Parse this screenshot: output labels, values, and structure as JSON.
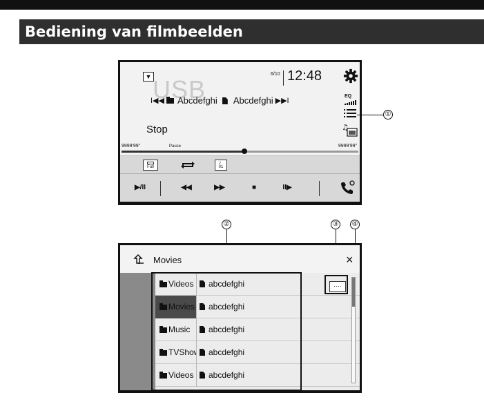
{
  "heading": "Bediening van filmbeelden",
  "player": {
    "dropdown_glyph": "▼",
    "source": "USB",
    "track_counter": "6/10",
    "clock": "12:48",
    "prev_glyph": "I◀◀",
    "folder_name": "Abcdefghi",
    "file_name": "Abcdefghi",
    "next_glyph": "▶▶I",
    "eq_label": "EQ",
    "status": "Stop",
    "time_elapsed": "9999'99\"",
    "pause_label": "Pause",
    "time_remaining": "9999'99\"",
    "progress_fraction": 0.52,
    "mode_full_label": "Full",
    "mode_shuffle_label": "01",
    "controls": {
      "play_pause": "▶/II",
      "rewind": "◀◀",
      "fast_forward": "▶▶",
      "stop": "■",
      "slow": "II▶"
    }
  },
  "callouts": [
    "①",
    "②",
    "③",
    "④"
  ],
  "list": {
    "title": "Movies",
    "close_glyph": "×",
    "more_label": "····",
    "scroll_fraction": 0.0,
    "rows": [
      {
        "folder": "Videos",
        "file": "abcdefghi",
        "selected": false
      },
      {
        "folder": "Movies",
        "file": "abcdefghi",
        "selected": true
      },
      {
        "folder": "Music",
        "file": "abcdefghi",
        "selected": false
      },
      {
        "folder": "TVShows",
        "file": "abcdefghi",
        "selected": false
      },
      {
        "folder": "Videos",
        "file": "abcdefghi",
        "selected": false
      }
    ]
  },
  "colors": {
    "heading_band": "#2f2f2f",
    "screen_bg": "#f2f2f2",
    "selected_folder": "#4a4a4a"
  }
}
